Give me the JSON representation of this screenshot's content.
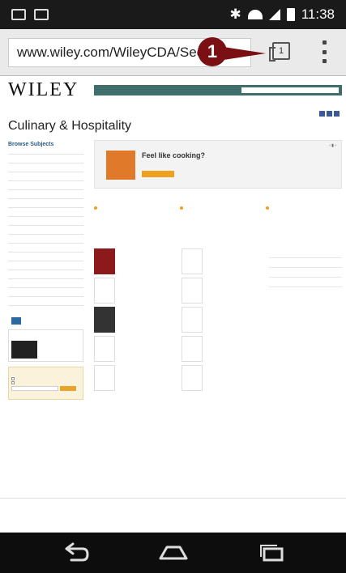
{
  "status_bar": {
    "time": "11:38"
  },
  "browser": {
    "url": "www.wiley.com/WileyCDA/Sec",
    "tabs_count": "1",
    "callout_number": "1"
  },
  "site": {
    "logo": "WILEY"
  },
  "page": {
    "title": "Culinary & Hospitality"
  },
  "sidebar": {
    "heading": "Browse Subjects"
  },
  "hero": {
    "title": "Feel like cooking?"
  }
}
